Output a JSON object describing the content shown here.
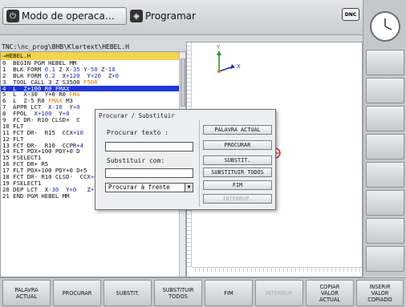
{
  "header": {
    "mode_machine": "Modo de operaca…",
    "mode_programming": "Programar",
    "dnc_label": "DNC"
  },
  "program": {
    "path": "TNC:\\nc_prog\\BHB\\Klartext\\HEBEL.H",
    "file_header": "→HEBEL.H",
    "lines": [
      [
        {
          "t": "0  BEGIN PGM HEBEL MM",
          "c": ""
        }
      ],
      [
        {
          "t": "1  BLK FORM ",
          "c": ""
        },
        {
          "t": "0.1",
          "c": "num"
        },
        {
          "t": " Z X",
          "c": ""
        },
        {
          "t": "-35",
          "c": "num"
        },
        {
          "t": " Y",
          "c": ""
        },
        {
          "t": "-50",
          "c": "num"
        },
        {
          "t": " Z",
          "c": ""
        },
        {
          "t": "-10",
          "c": "num"
        }
      ],
      [
        {
          "t": "2  BLK FORM ",
          "c": ""
        },
        {
          "t": "0.2",
          "c": "num"
        },
        {
          "t": "  X",
          "c": ""
        },
        {
          "t": "+120",
          "c": "num"
        },
        {
          "t": "  Y",
          "c": ""
        },
        {
          "t": "+20",
          "c": "num"
        },
        {
          "t": "  Z",
          "c": ""
        },
        {
          "t": "+0",
          "c": "num"
        }
      ],
      [
        {
          "t": "3  TOOL CALL 3 Z S3500 ",
          "c": ""
        },
        {
          "t": "F500",
          "c": "ora"
        }
      ],
      [
        {
          "t": "4  L  Z+100 R0 FMAX",
          "c": ""
        }
      ],
      [
        {
          "t": "5  L  X-30  Y+0 R0 ",
          "c": ""
        },
        {
          "t": "FMA",
          "c": "ora"
        }
      ],
      [
        {
          "t": "6  L  Z-5 R0 ",
          "c": ""
        },
        {
          "t": "FMAX",
          "c": "ora"
        },
        {
          "t": " M3",
          "c": ""
        }
      ],
      [
        {
          "t": "7  APPR LCT  X",
          "c": ""
        },
        {
          "t": "-10",
          "c": "num"
        },
        {
          "t": "  Y",
          "c": ""
        },
        {
          "t": "+0",
          "c": "num"
        }
      ],
      [
        {
          "t": "8  FPOL  X",
          "c": ""
        },
        {
          "t": "+100",
          "c": "num"
        },
        {
          "t": "  Y",
          "c": ""
        },
        {
          "t": "+0",
          "c": "num"
        }
      ],
      [
        {
          "t": "9  FC DR- R10 CLSD+  C",
          "c": ""
        }
      ],
      [
        {
          "t": "10 FLT",
          "c": ""
        }
      ],
      [
        {
          "t": "11 FCT DR-  R15  CCX",
          "c": ""
        },
        {
          "t": "+10",
          "c": "num"
        }
      ],
      [
        {
          "t": "12 FLT",
          "c": ""
        }
      ],
      [
        {
          "t": "13 FCT DR-  R10  CCPR",
          "c": ""
        },
        {
          "t": "+4",
          "c": "num"
        }
      ],
      [
        {
          "t": "14 FLT PDX+100 PDY+0 D",
          "c": ""
        }
      ],
      [
        {
          "t": "15 FSELECT1",
          "c": ""
        }
      ],
      [
        {
          "t": "16 FCT DR+ R5",
          "c": ""
        }
      ],
      [
        {
          "t": "17 FLT PDX+100 PDY+0 D",
          "c": ""
        },
        {
          "t": "+5",
          "c": ""
        }
      ],
      [
        {
          "t": "18 FCT DR- R10 CLSD-  CCX",
          "c": ""
        },
        {
          "t": "+0",
          "c": "num"
        },
        {
          "t": "  CCY",
          "c": ""
        },
        {
          "t": "+0",
          "c": "num"
        }
      ],
      [
        {
          "t": "19 FSELECT1",
          "c": ""
        }
      ],
      [
        {
          "t": "20 DEP LCT  X",
          "c": ""
        },
        {
          "t": "-30",
          "c": "num"
        },
        {
          "t": "  Y",
          "c": ""
        },
        {
          "t": "+0",
          "c": "num"
        },
        {
          "t": "   Z",
          "c": ""
        },
        {
          "t": "+100",
          "c": "num"
        },
        {
          "t": " R5 ",
          "c": ""
        },
        {
          "t": "FMAX",
          "c": "ora"
        }
      ],
      [
        {
          "t": "21 END PGM HEBEL MM",
          "c": ""
        }
      ]
    ]
  },
  "graphics": {
    "axis_y": "Y",
    "axis_x": "X"
  },
  "dialog": {
    "title": "Procurar / Substituir",
    "search_label": "Procurar texto :",
    "search_value": "",
    "replace_label": "Substituir com:",
    "replace_value": "",
    "direction_value": "Procurar à frente",
    "buttons": [
      "PALAVRA ACTUAL",
      "PROCURAR",
      "SUBSTIT.",
      "SUBSTITUIR TODOS",
      "FIM",
      "INTERRUP."
    ]
  },
  "softkeys": [
    {
      "label": "PALAVRA\nACTUAL",
      "enabled": true
    },
    {
      "label": "PROCURAR",
      "enabled": true
    },
    {
      "label": "SUBSTIT.",
      "enabled": true
    },
    {
      "label": "SUBSTITUIR\nTODOS",
      "enabled": true
    },
    {
      "label": "FIM",
      "enabled": true
    },
    {
      "label": "INTERRUP.",
      "enabled": false
    },
    {
      "label": "COPIAR\nVALOR\nACTUAL",
      "enabled": true
    },
    {
      "label": "INSERIR\nVALOR\nCOPIADO",
      "enabled": true
    }
  ],
  "colors": {
    "selection": "#1e36d8",
    "header_yellow": "#f3d44e",
    "numbers": "#1a2fb8",
    "feed": "#e07b00"
  }
}
